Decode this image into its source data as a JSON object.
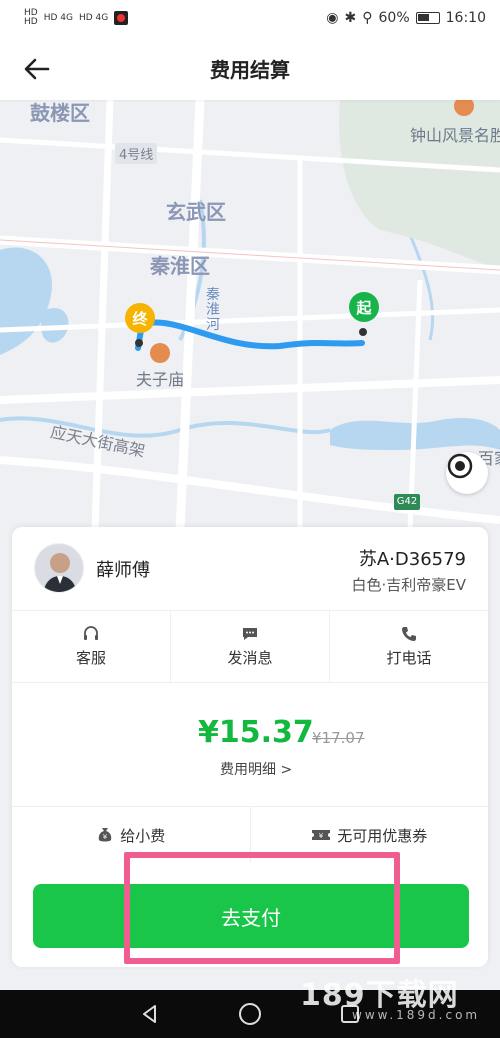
{
  "status_bar": {
    "left_tags": [
      "HD 4G",
      "HD 4G"
    ],
    "battery": "60%",
    "time": "16:10"
  },
  "header": {
    "title": "费用结算",
    "back_icon": "arrow-left-icon"
  },
  "map": {
    "labels": {
      "gulou": "鼓楼区",
      "xuanwu": "玄武区",
      "qinhuai": "秦淮区",
      "line4": "4号线",
      "zhongshan": "钟山风景名胜",
      "qinhuai_river": "秦淮河",
      "fuzimiao": "夫子庙",
      "yingtian": "应天大街高架",
      "baixia": "百家",
      "road_sign": "G42"
    },
    "start_pin": "起",
    "end_pin": "终"
  },
  "driver": {
    "name": "薛师傅",
    "plate": "苏A·D36579",
    "car": "白色·吉利帝豪EV"
  },
  "actions": [
    {
      "label": "客服",
      "icon": "headset-icon"
    },
    {
      "label": "发消息",
      "icon": "chat-bubble-icon"
    },
    {
      "label": "打电话",
      "icon": "phone-icon"
    }
  ],
  "price": {
    "amount": "¥15.37",
    "original": "¥17.07",
    "detail_link": "费用明细 >"
  },
  "extras": {
    "tip": "给小费",
    "coupon": "无可用优惠券"
  },
  "pay_button": "去支付",
  "watermark": {
    "main": "189下载网",
    "sub": "www.189d.com"
  },
  "colors": {
    "accent_green": "#19c64a",
    "price_green": "#13b83f",
    "route_blue": "#2f9bf0",
    "highlight_pink": "#ef5d91"
  }
}
